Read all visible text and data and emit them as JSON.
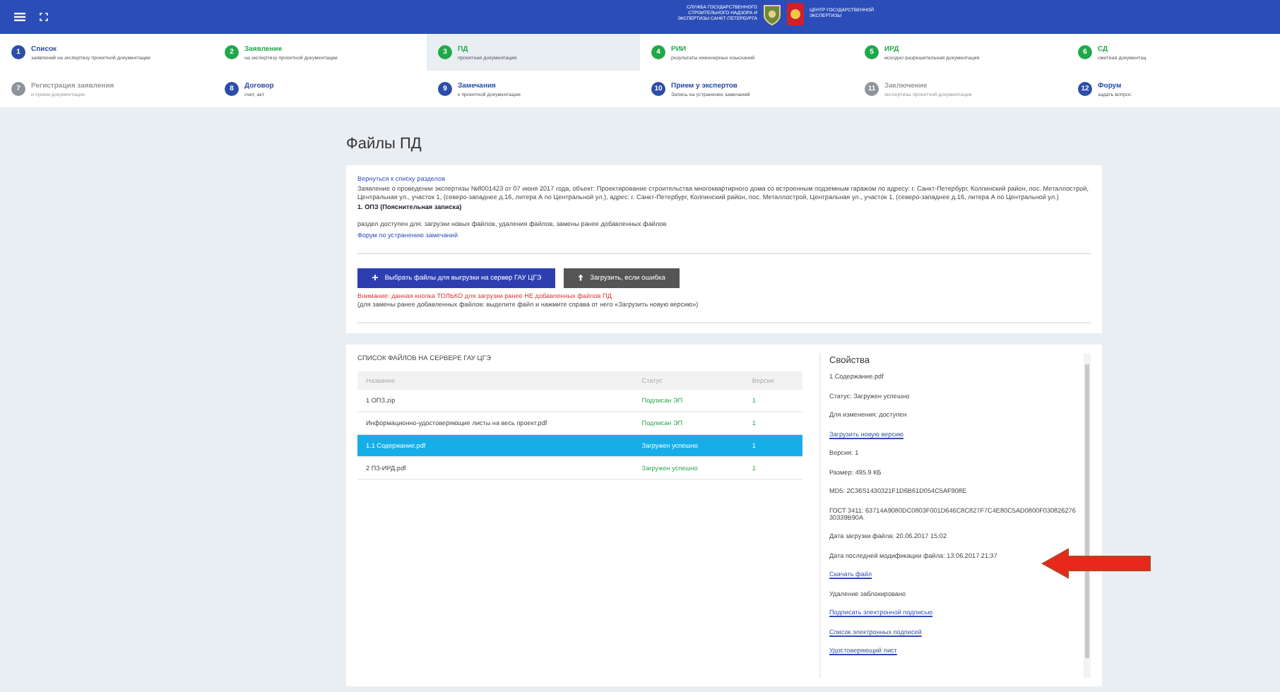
{
  "header": {
    "logos": [
      {
        "kind": "shield",
        "text": "СЛУЖБА ГОСУДАРСТВЕННОГО СТРОИТЕЛЬНОГО НАДЗОРА И ЭКСПЕРТИЗЫ САНКТ-ПЕТЕРБУРГА"
      },
      {
        "kind": "emblem",
        "text": "ЦЕНТР ГОСУДАРСТВЕННОЙ ЭКСПЕРТИЗЫ"
      }
    ]
  },
  "steps": [
    {
      "number": "1",
      "title": "Список",
      "subtitle": "заявлений на экспертизу проектной документации",
      "kind": "active",
      "selected": false
    },
    {
      "number": "2",
      "title": "Заявление",
      "subtitle": "на экспертизу проектной документации",
      "kind": "done",
      "selected": false
    },
    {
      "number": "3",
      "title": "ПД",
      "subtitle": "проектная документация",
      "kind": "done",
      "selected": true
    },
    {
      "number": "4",
      "title": "РИИ",
      "subtitle": "результаты инженерных изысканий",
      "kind": "done",
      "selected": false
    },
    {
      "number": "5",
      "title": "ИРД",
      "subtitle": "исходно-разрешительная документация",
      "kind": "done",
      "selected": false
    },
    {
      "number": "6",
      "title": "СД",
      "subtitle": "сметная документац",
      "kind": "done",
      "selected": false
    },
    {
      "number": "7",
      "title": "Регистрация заявления",
      "subtitle": "и прием документации",
      "kind": "disabled",
      "selected": false
    },
    {
      "number": "8",
      "title": "Договор",
      "subtitle": "счет, акт",
      "kind": "active",
      "selected": false
    },
    {
      "number": "9",
      "title": "Замечания",
      "subtitle": "к проектной документации",
      "kind": "active",
      "selected": false
    },
    {
      "number": "10",
      "title": "Прием у экспертов",
      "subtitle": "Запись на устранение замечаний",
      "kind": "active",
      "selected": false
    },
    {
      "number": "11",
      "title": "Заключение",
      "subtitle": "экспертизы проектной документации",
      "kind": "disabled",
      "selected": false
    },
    {
      "number": "12",
      "title": "Форум",
      "subtitle": "задать вопрос",
      "kind": "active",
      "selected": false
    }
  ],
  "page_title": "Файлы ПД",
  "card": {
    "back_link": "Вернуться к списку разделов",
    "description": "Заявление о проведении экспертизы №8001423 от 07 июня 2017 года, объект: Проектирование строительства многоквартирного дома со встроенным подземным гаражом по адресу: г. Санкт-Петербург, Колпинский район, пос. Металлострой, Центральная ул., участок 1, (северо-западнее д.16, литера А по Центральной ул.), адрес: г. Санкт-Петербург, Колпинский район, пос. Металлострой, Центральная ул., участок 1, (северо-западнее д.16, литера А по Центральной ул.)",
    "section": "1. ОПЗ (Пояснительная записка)",
    "access": "раздел доступен для: загрузки новых файлов, удаления файлов, замены ранее добавленных файлов",
    "forum_link": "Форум по устранению замечаний",
    "buttons": [
      {
        "kind": "primary",
        "label": "Выбрать файлы для выгрузки на сервер ГАУ ЦГЭ"
      },
      {
        "kind": "secondary",
        "label": "Загрузить, если ошибка"
      }
    ],
    "warning": "Внимание: данная кнопка ТОЛЬКО для загрузки ранее НЕ добавленных файлов ПД",
    "hint": "(для замены ранее добавленных файлов: выделите файл и нажмите справа от него «Загрузить новую версию»)"
  },
  "files": {
    "title": "СПИСОК ФАЙЛОВ НА СЕРВЕРЕ ГАУ ЦГЭ",
    "columns": [
      "Название",
      "Статус",
      "Версия"
    ],
    "rows": [
      {
        "name": "1 ОПЗ.zip",
        "status": "Подписан ЭП",
        "version": "1",
        "selected": false
      },
      {
        "name": "Информационно-удостоверяющие листы на весь проект.pdf",
        "status": "Подписан ЭП",
        "version": "1",
        "selected": false
      },
      {
        "name": "1.1 Содержание.pdf",
        "status": "Загружен успешно",
        "version": "1",
        "selected": true
      },
      {
        "name": "2 ПЗ-ИРД.pdf",
        "status": "Загружен успешно",
        "version": "1",
        "selected": false
      }
    ]
  },
  "properties": {
    "title": "Свойства",
    "items": [
      {
        "kind": "text",
        "text": "1 Содержание.pdf"
      },
      {
        "kind": "text",
        "text": "Статус: Загружен успешно"
      },
      {
        "kind": "text",
        "text": "Для изменения: доступен"
      },
      {
        "kind": "link",
        "text": "Загрузить новую версию"
      },
      {
        "kind": "text",
        "text": "Версия: 1"
      },
      {
        "kind": "text",
        "text": "Размер: 495.9 КБ"
      },
      {
        "kind": "text",
        "text": "MD5: 2C36S1430321F1D6B61D054C5AF908E"
      },
      {
        "kind": "text",
        "text": "ГОСТ 3411: 63714A9080DC0803F001D646C8C827F7C4E80C5AD0800F03082627630339B90A"
      },
      {
        "kind": "text",
        "text": "Дата загрузки файла: 20.06.2017 15:02"
      },
      {
        "kind": "text",
        "text": "Дата последней модификации файла: 13.06.2017 21:37"
      },
      {
        "kind": "link",
        "text": "Скачать файл"
      },
      {
        "kind": "text",
        "text": "Удаление заблокировано"
      },
      {
        "kind": "link",
        "text": "Подписать электронной подписью"
      },
      {
        "kind": "link",
        "text": "Список электронных подписей"
      },
      {
        "kind": "link",
        "text": "Удостоверяющий лист"
      }
    ]
  }
}
